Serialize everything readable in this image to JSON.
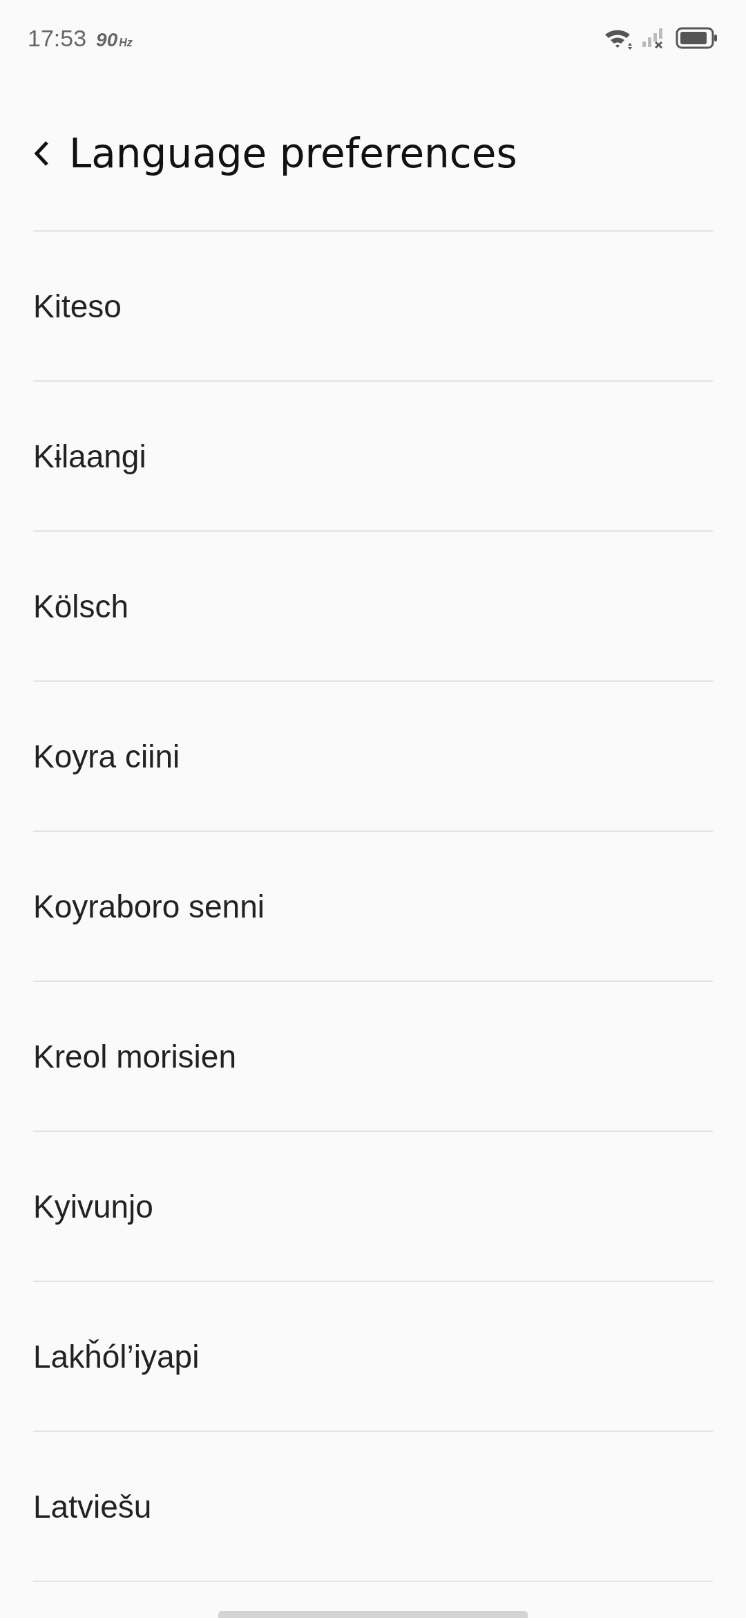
{
  "status_bar": {
    "time": "17:53",
    "refresh_rate": "90",
    "refresh_unit": "Hz"
  },
  "header": {
    "title": "Language preferences"
  },
  "languages": [
    {
      "label": "Kiteso"
    },
    {
      "label": "Kɨlaangi"
    },
    {
      "label": "Kölsch"
    },
    {
      "label": "Koyra ciini"
    },
    {
      "label": "Koyraboro senni"
    },
    {
      "label": "Kreol morisien"
    },
    {
      "label": "Kyivunjo"
    },
    {
      "label": "Lakȟól’iyapi"
    },
    {
      "label": "Latviešu"
    }
  ]
}
